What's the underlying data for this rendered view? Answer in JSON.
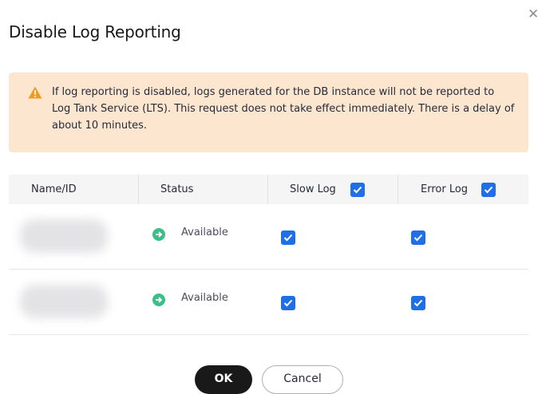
{
  "dialog": {
    "title": "Disable Log Reporting",
    "close_icon": "close-icon",
    "alert": {
      "icon": "warning-icon",
      "message": "If log reporting is disabled, logs generated for the DB instance will not be reported to Log Tank Service (LTS). This request does not take effect immediately. There is a delay of about 10 minutes."
    },
    "table": {
      "columns": [
        "Name/ID",
        "Status",
        "Slow Log",
        "Error Log"
      ],
      "header_checks": {
        "slow_log": true,
        "error_log": true
      },
      "rows": [
        {
          "status": "Available",
          "slow_log": true,
          "error_log": true
        },
        {
          "status": "Available",
          "slow_log": true,
          "error_log": true
        }
      ]
    },
    "buttons": {
      "ok": "OK",
      "cancel": "Cancel"
    }
  },
  "colors": {
    "alert_bg": "#fde6cf",
    "warning": "#f29a1f",
    "status_available": "#3bbf8a",
    "checkbox": "#1e6fe8",
    "primary_button": "#191919"
  }
}
